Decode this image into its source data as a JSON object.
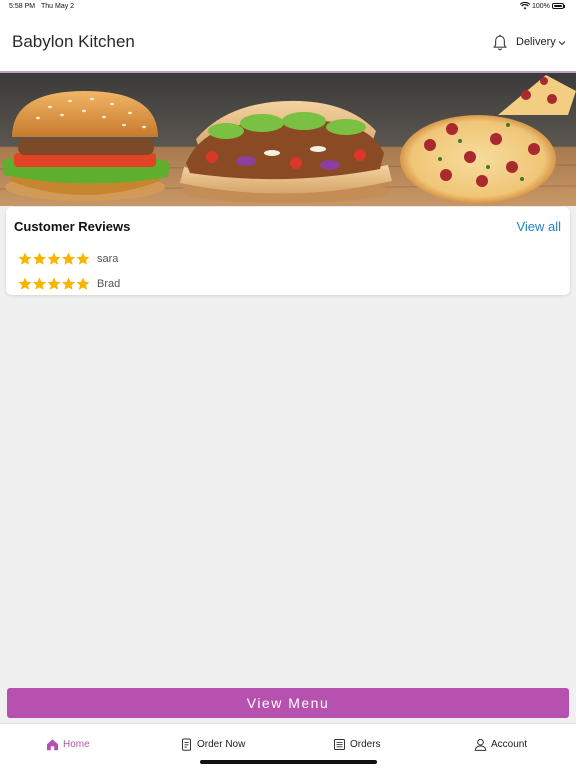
{
  "status_bar": {
    "time": "5:58 PM",
    "date": "Thu May 2",
    "battery": "100%"
  },
  "header": {
    "title": "Babylon Kitchen",
    "order_mode": "Delivery",
    "bell_icon": "bell-icon",
    "chevron_icon": "chevron-down-icon"
  },
  "hero": {
    "items": [
      "burger",
      "doner-wrap",
      "pizza"
    ]
  },
  "reviews": {
    "heading": "Customer Reviews",
    "view_all": "View all",
    "items": [
      {
        "name": "sara",
        "rating": 5
      },
      {
        "name": "Brad",
        "rating": 5
      }
    ],
    "star_color": "#f7b500"
  },
  "cta": {
    "label": "View Menu",
    "color": "#b751b0"
  },
  "tabs": [
    {
      "label": "Home",
      "icon": "home-icon",
      "active": true
    },
    {
      "label": "Order Now",
      "icon": "order-icon",
      "active": false
    },
    {
      "label": "Orders",
      "icon": "receipt-icon",
      "active": false
    },
    {
      "label": "Account",
      "icon": "user-icon",
      "active": false
    }
  ],
  "colors": {
    "accent": "#b751b0",
    "link": "#1f86c0",
    "background": "#f0f0f0"
  }
}
